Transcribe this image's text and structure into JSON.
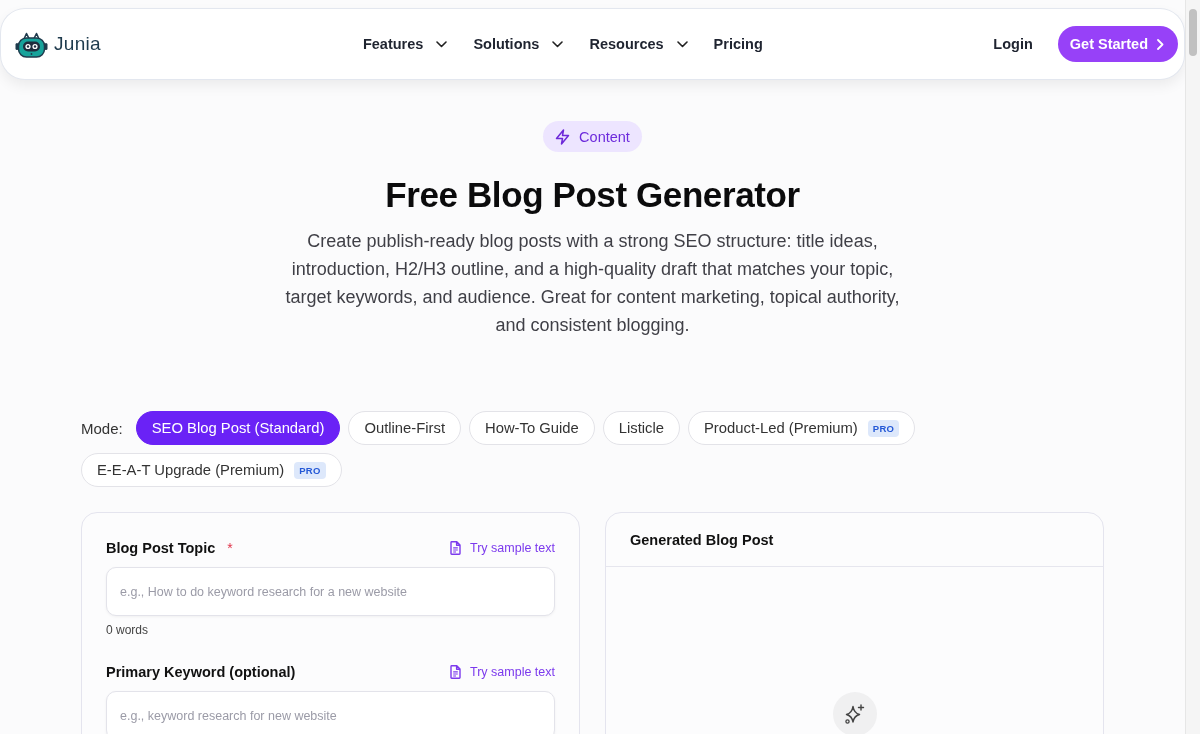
{
  "header": {
    "logo": {
      "text": "Junia"
    },
    "nav": [
      {
        "label": "Features",
        "dropdown": true
      },
      {
        "label": "Solutions",
        "dropdown": true
      },
      {
        "label": "Resources",
        "dropdown": true
      },
      {
        "label": "Pricing",
        "dropdown": false
      }
    ],
    "login": "Login",
    "cta": "Get Started"
  },
  "hero": {
    "category": "Content",
    "title": "Free Blog Post Generator",
    "description": "Create publish-ready blog posts with a strong SEO structure: title ideas, introduction, H2/H3 outline, and a high-quality draft that matches your topic, target keywords, and audience. Great for content marketing, topical authority, and consistent blogging."
  },
  "modes": {
    "label": "Mode:",
    "options": [
      {
        "label": "SEO Blog Post (Standard)",
        "selected": true
      },
      {
        "label": "Outline-First",
        "selected": false
      },
      {
        "label": "How-To Guide",
        "selected": false
      },
      {
        "label": "Listicle",
        "selected": false
      },
      {
        "label": "Product-Led (Premium)",
        "selected": false,
        "badge": "PRO"
      },
      {
        "label": "E-E-A-T Upgrade (Premium)",
        "selected": false,
        "badge": "PRO"
      }
    ]
  },
  "form": {
    "fields": [
      {
        "label": "Blog Post Topic",
        "required_mark": "*",
        "sample_link": "Try sample text",
        "placeholder": "e.g., How to do keyword research for a new website",
        "word_count": "0 words"
      },
      {
        "label": "Primary Keyword (optional)",
        "sample_link": "Try sample text",
        "placeholder": "e.g., keyword research for new website"
      }
    ]
  },
  "output": {
    "title": "Generated Blog Post"
  }
}
